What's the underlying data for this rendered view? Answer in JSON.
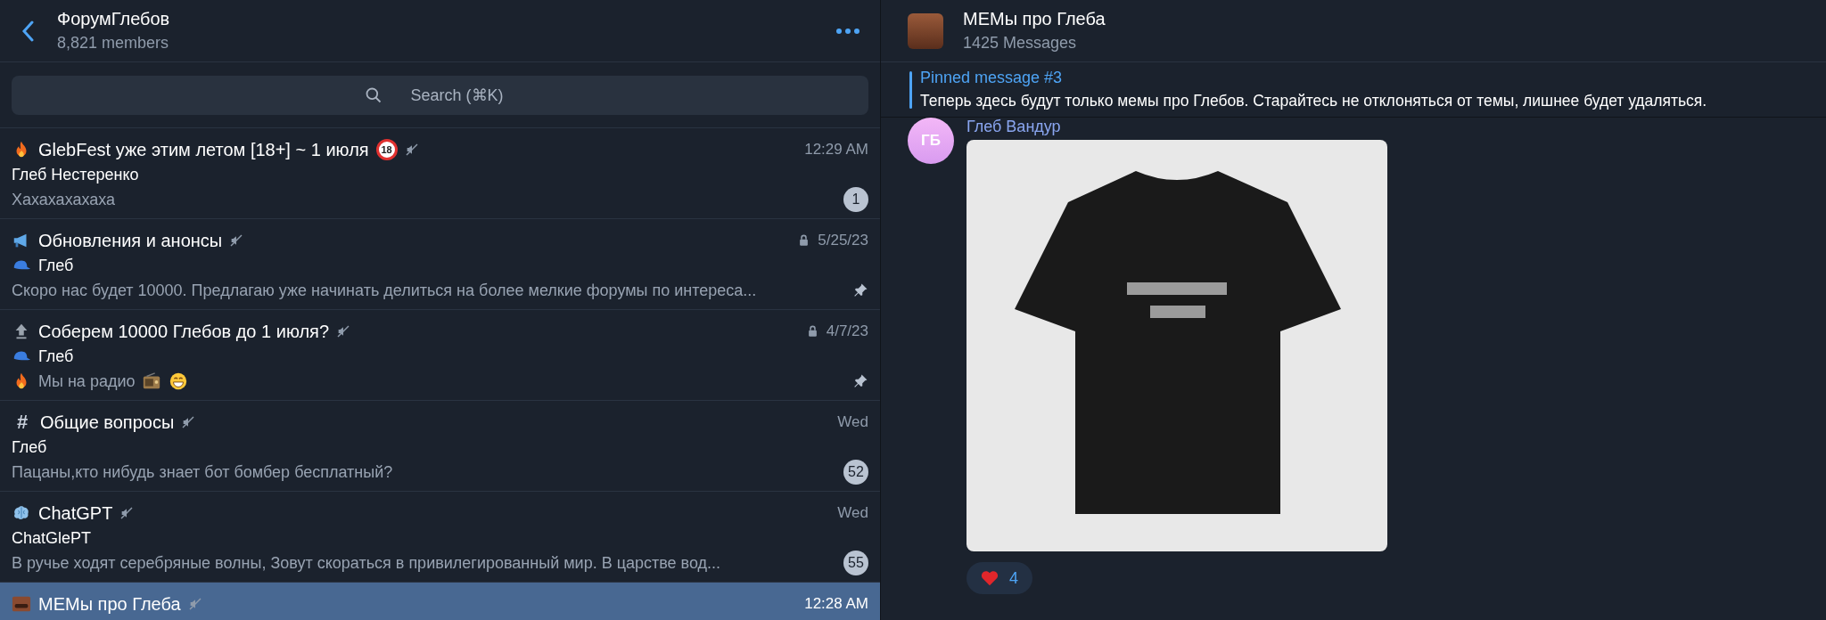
{
  "forum": {
    "title": "ФорумГлебов",
    "subtitle": "8,821 members"
  },
  "search": {
    "placeholder": "Search (⌘K)"
  },
  "topics": [
    {
      "kind": "fire",
      "title": "GlebFest уже этим летом [18+] ~ 1 июля",
      "age_badge": "18",
      "muted": true,
      "locked": false,
      "time": "12:29 AM",
      "sender": [
        {
          "kind": "text",
          "text": "Глеб Нестеренко"
        }
      ],
      "preview": [
        {
          "kind": "text",
          "text": "Хахахахахаха"
        }
      ],
      "pinned": false,
      "unread": "1",
      "selected": false
    },
    {
      "kind": "megaphone",
      "title": "Обновления и анонсы",
      "muted": true,
      "locked": true,
      "time": "5/25/23",
      "sender": [
        {
          "kind": "cap"
        },
        {
          "kind": "text",
          "text": "Глеб"
        }
      ],
      "preview": [
        {
          "kind": "text",
          "text": "Скоро нас будет 10000. Предлагаю уже начинать делиться на более мелкие форумы по интереса..."
        }
      ],
      "pinned": true,
      "selected": false
    },
    {
      "kind": "top",
      "title": "Соберем 10000 Глебов до 1 июля?",
      "muted": true,
      "locked": true,
      "time": "4/7/23",
      "sender": [
        {
          "kind": "cap"
        },
        {
          "kind": "text",
          "text": "Глеб"
        }
      ],
      "preview": [
        {
          "kind": "fire"
        },
        {
          "kind": "text",
          "text": "Мы на радио"
        },
        {
          "kind": "radio"
        },
        {
          "kind": "grin"
        }
      ],
      "pinned": true,
      "selected": false
    },
    {
      "kind": "hash",
      "icon_text": "#",
      "title": "Общие вопросы",
      "muted": true,
      "locked": false,
      "time": "Wed",
      "sender": [
        {
          "kind": "text",
          "text": "Глеб"
        }
      ],
      "preview": [
        {
          "kind": "text",
          "text": "Пацаны,кто нибудь знает бот бомбер бесплатный?"
        }
      ],
      "pinned": false,
      "unread": "52",
      "selected": false
    },
    {
      "kind": "brain",
      "title": "ChatGPT",
      "muted": true,
      "locked": false,
      "time": "Wed",
      "sender": [
        {
          "kind": "text",
          "text": "ChatGlePT"
        }
      ],
      "preview": [
        {
          "kind": "text",
          "text": "В ручье ходят серебряные волны,   Зовут скораться в привилегированный мир.   В царстве вод..."
        }
      ],
      "pinned": false,
      "unread": "55",
      "selected": false
    },
    {
      "kind": "photo",
      "title": "МЕМы про Глеба",
      "muted": true,
      "locked": false,
      "time": "12:28 AM",
      "pinned": false,
      "selected": true
    }
  ],
  "chat": {
    "title": "МЕМы про Глеба",
    "subtitle": "1425 Messages"
  },
  "pinned": {
    "title": "Pinned message #3",
    "text": "Теперь здесь будут только мемы про Глебов. Старайтесь не отклоняться от темы, лишнее будет удаляться."
  },
  "message": {
    "avatar_initials": "ГБ",
    "sender": "Глеб Вандур",
    "reactions": [
      {
        "count": "4"
      }
    ]
  }
}
